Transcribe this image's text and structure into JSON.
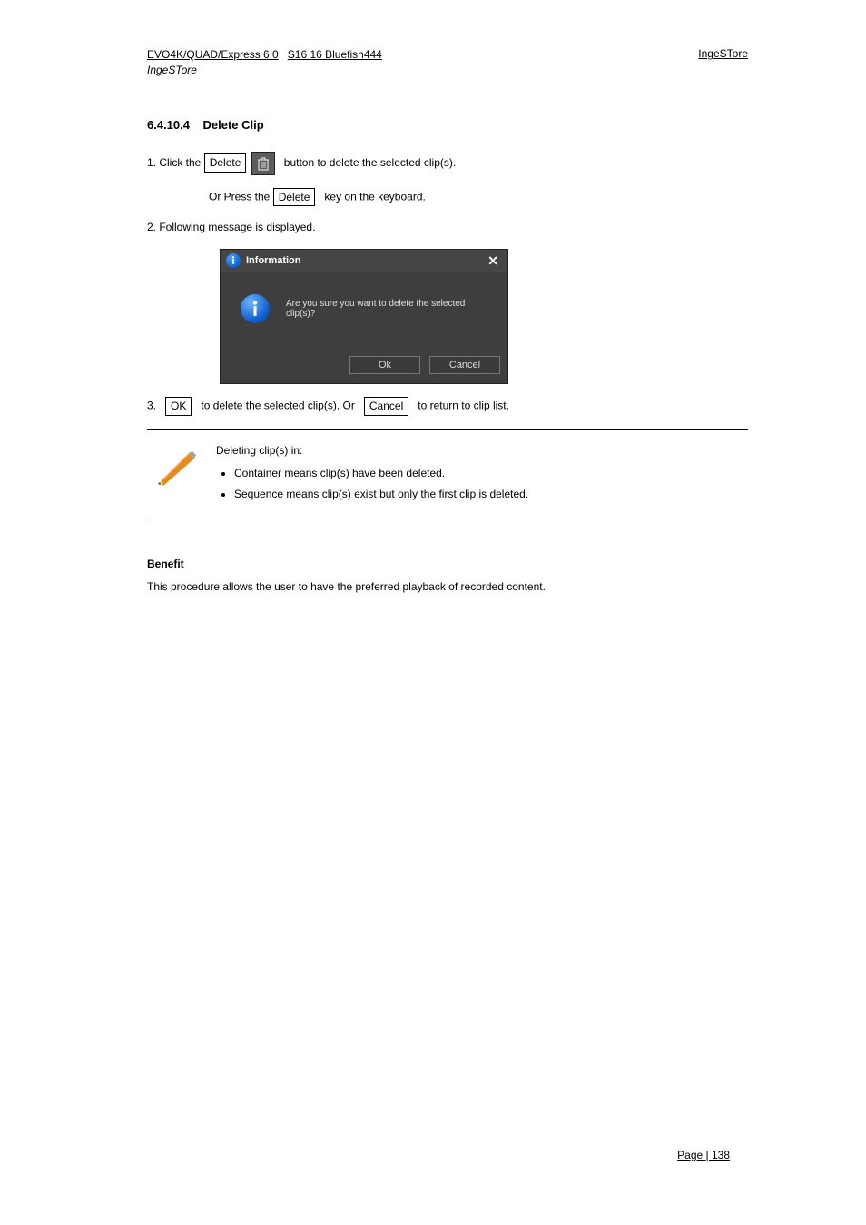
{
  "header": {
    "model_line": "EVO4K/QUAD/Express 6.0",
    "company_line": "S16 16 Bluefish444",
    "section_line": "IngeSTore",
    "page_name": "IngeSTore"
  },
  "heading_number": "6.4.10.4",
  "heading_text": "Delete Clip",
  "steps": {
    "s1_prefix": "1. Click the",
    "s1_btn": "Delete",
    "s1_suffix": "button to delete the selected clip(s).",
    "s1_post": "Or Press the",
    "s1_key": "Delete",
    "s1_post2": "key on the keyboard.",
    "s2": "2. Following message is displayed.",
    "s3_prefix": "3.",
    "s3_ok": "OK",
    "s3_mid": "to delete the selected clip(s). Or",
    "s3_cancel": "Cancel",
    "s3_suffix": "to return to clip list."
  },
  "dialog": {
    "title": "Information",
    "message": "Are you sure you want to delete the selected clip(s)?",
    "ok": "Ok",
    "cancel": "Cancel"
  },
  "note": {
    "intro": "Deleting clip(s) in:",
    "li1": "Container means clip(s) have been deleted.",
    "li2": "Sequence means clip(s) exist but only the first clip is deleted."
  },
  "benefit": {
    "title": "Benefit",
    "text": "This procedure allows the user to have the preferred playback of recorded content."
  },
  "page_number": "Page | 138"
}
